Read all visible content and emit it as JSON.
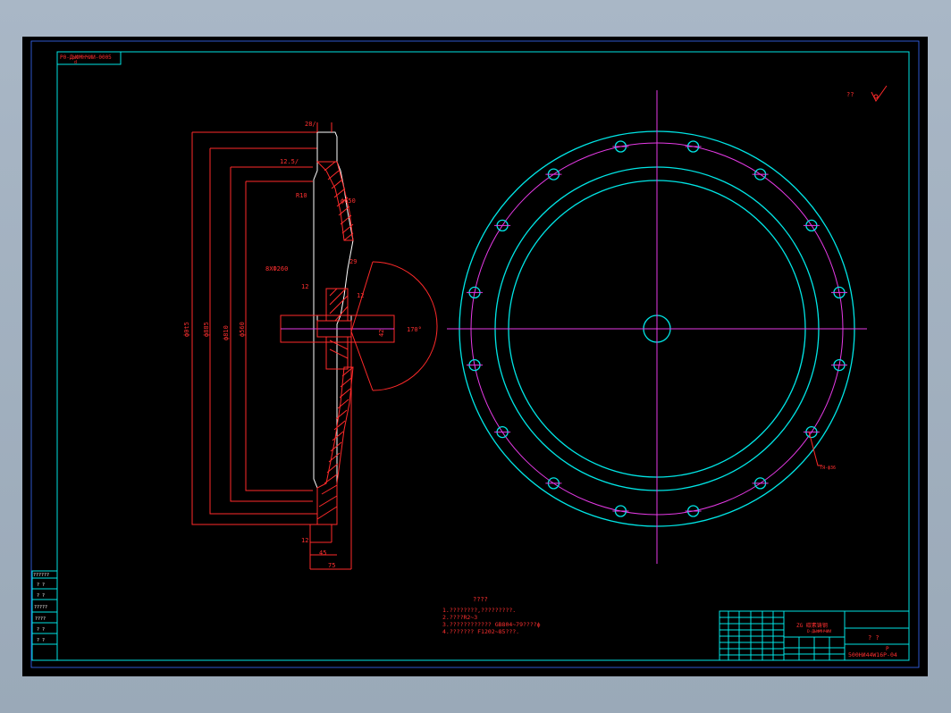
{
  "drawing_code_top": "P0-ДЫФМНЧИИ-0005",
  "drawing_code_top_sub": "d",
  "roughness_global": "??",
  "dimensions": {
    "left_outer": "ф0t5",
    "left_mid": "ф885",
    "left_inner": "ф810",
    "left_inner2": "ф560",
    "roughness_a": "28/",
    "roughness_b": "12.5/",
    "r10": "R10",
    "d650": "ф650",
    "hole_spec": "8XФ260",
    "d29": "29",
    "d12a": "12",
    "d12b": "12",
    "d12c": "12",
    "angle": "170°",
    "d42": "42",
    "d75": "75",
    "d45": "45",
    "bolt_note": "ТЯ-ф36"
  },
  "notes": {
    "title": "????",
    "line1": "1.????????,?????????.",
    "line2": "2.????R2~3",
    "line3": "3.???????????? GB804~79????ф",
    "line4": "4.??????? F1202~85???."
  },
  "title_block": {
    "title_main": "ZG 碳素铸钢",
    "title_sub": "D-ДЫФМНЧИИ",
    "company": "? ?",
    "drawing_number": "500НИ44W16Р-04",
    "small": "Р"
  },
  "side_table": [
    "??????",
    "? ?",
    "? ?",
    "?????",
    "????",
    "? ?",
    "? ?"
  ]
}
